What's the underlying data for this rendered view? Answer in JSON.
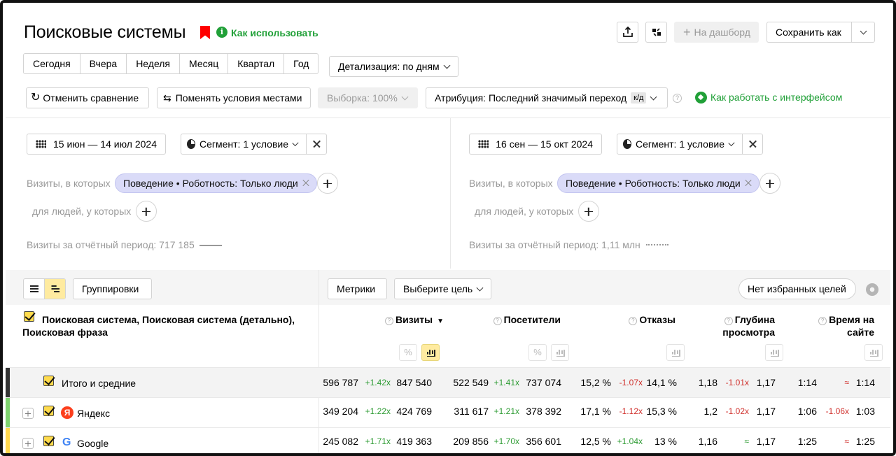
{
  "header": {
    "title": "Поисковые системы",
    "howto_label": "Как использовать",
    "howto_icon": "info-icon",
    "dashboard_label": "На дашборд",
    "save_as_label": "Сохранить как"
  },
  "periods": [
    "Сегодня",
    "Вчера",
    "Неделя",
    "Месяц",
    "Квартал",
    "Год"
  ],
  "detail_label": "Детализация: по дням",
  "toolbar2": {
    "cancel_compare": "Отменить сравнение",
    "swap_conditions": "Поменять условия местами",
    "sample": "Выборка: 100%",
    "attribution": "Атрибуция: Последний значимый переход",
    "attribution_badge": "к/д",
    "how_gui": "Как работать с интерфейсом"
  },
  "segments": [
    {
      "date_range": "15 июн — 14 июл 2024",
      "segment_label": "Сегмент: 1 условие",
      "visits_where": "Визиты, в которых",
      "chip_key": "Поведение",
      "chip_sep": "•",
      "chip_value": "Роботность: Только люди",
      "people_where": "для людей, у которых",
      "visits_total": "Визиты за отчётный период: 717 185"
    },
    {
      "date_range": "16 сен — 15 окт 2024",
      "segment_label": "Сегмент: 1 условие",
      "visits_where": "Визиты, в которых",
      "chip_key": "Поведение",
      "chip_sep": "•",
      "chip_value": "Роботность: Только люди",
      "people_where": "для людей, у которых",
      "visits_total": "Визиты за отчётный период: 1,11 млн"
    }
  ],
  "table_toolbar": {
    "groupings": "Группировки",
    "metrics": "Метрики",
    "choose_goal": "Выберите цель",
    "no_fav_goals": "Нет избранных целей"
  },
  "table": {
    "dimension_title": "Поисковая система, Поисковая система (детально), Поисковая фраза",
    "sort_marker": "▼",
    "metric_headers": [
      "Визиты",
      "Посетители",
      "Отказы",
      "Глубина просмотра",
      "Время на сайте"
    ],
    "percent_glyph": "%",
    "rows": [
      {
        "label": "Итого и средние",
        "accent": "#333333",
        "cells": [
          [
            "596 787",
            "+1.42x",
            "847 540"
          ],
          [
            "522 549",
            "+1.41x",
            "737 074"
          ],
          [
            "15,2 %",
            "-1.07x",
            "14,1 %"
          ],
          [
            "1,18",
            "-1.01x",
            "1,17"
          ],
          [
            "1:14",
            "≈",
            "1:14"
          ]
        ]
      },
      {
        "label": "Яндекс",
        "logo": "Я",
        "accent": "#7ed36e",
        "cells": [
          [
            "349 204",
            "+1.22x",
            "424 769"
          ],
          [
            "311 617",
            "+1.21x",
            "378 392"
          ],
          [
            "17,1 %",
            "-1.12x",
            "15,3 %"
          ],
          [
            "1,2",
            "-1.02x",
            "1,17"
          ],
          [
            "1:06",
            "-1.06x",
            "1:03"
          ]
        ]
      },
      {
        "label": "Google",
        "logo": "G",
        "accent": "#ffd84d",
        "cells": [
          [
            "245 082",
            "+1.71x",
            "419 363"
          ],
          [
            "209 856",
            "+1.70x",
            "356 601"
          ],
          [
            "12,5 %",
            "+1.04x",
            "13 %"
          ],
          [
            "1,16",
            "≈",
            "1,17"
          ],
          [
            "1:25",
            "≈",
            "1:25"
          ]
        ]
      }
    ]
  },
  "colors": {
    "accent_green": "#21a038",
    "chip_bg": "#dadbf8",
    "yellow": "#ffdb4d"
  }
}
